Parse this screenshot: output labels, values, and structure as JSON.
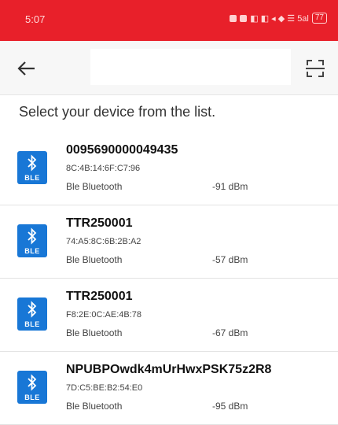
{
  "status_bar": {
    "time": "5:07",
    "indicators": "◧ ◧ ◂ ◆ ☰ 5al",
    "battery": "77",
    "color": "#e8202a"
  },
  "app_bar": {
    "back_icon": "arrow-left-icon",
    "scan_icon": "scan-frame-icon"
  },
  "instruction": "Select your device from the list.",
  "devices": [
    {
      "name": "0095690000049435",
      "mac": "8C:4B:14:6F:C7:96",
      "type": "Ble Bluetooth",
      "rssi": "-91 dBm",
      "icon_label": "BLE"
    },
    {
      "name": "TTR250001",
      "mac": "74:A5:8C:6B:2B:A2",
      "type": "Ble Bluetooth",
      "rssi": "-57 dBm",
      "icon_label": "BLE"
    },
    {
      "name": "TTR250001",
      "mac": "F8:2E:0C:AE:4B:78",
      "type": "Ble Bluetooth",
      "rssi": "-67 dBm",
      "icon_label": "BLE"
    },
    {
      "name": "NPUBPOwdk4mUrHwxPSK75z2R8",
      "mac": "7D:C5:BE:B2:54:E0",
      "type": "Ble Bluetooth",
      "rssi": "-95 dBm",
      "icon_label": "BLE"
    }
  ],
  "colors": {
    "accent": "#e8202a",
    "ble_icon": "#1877d6"
  }
}
